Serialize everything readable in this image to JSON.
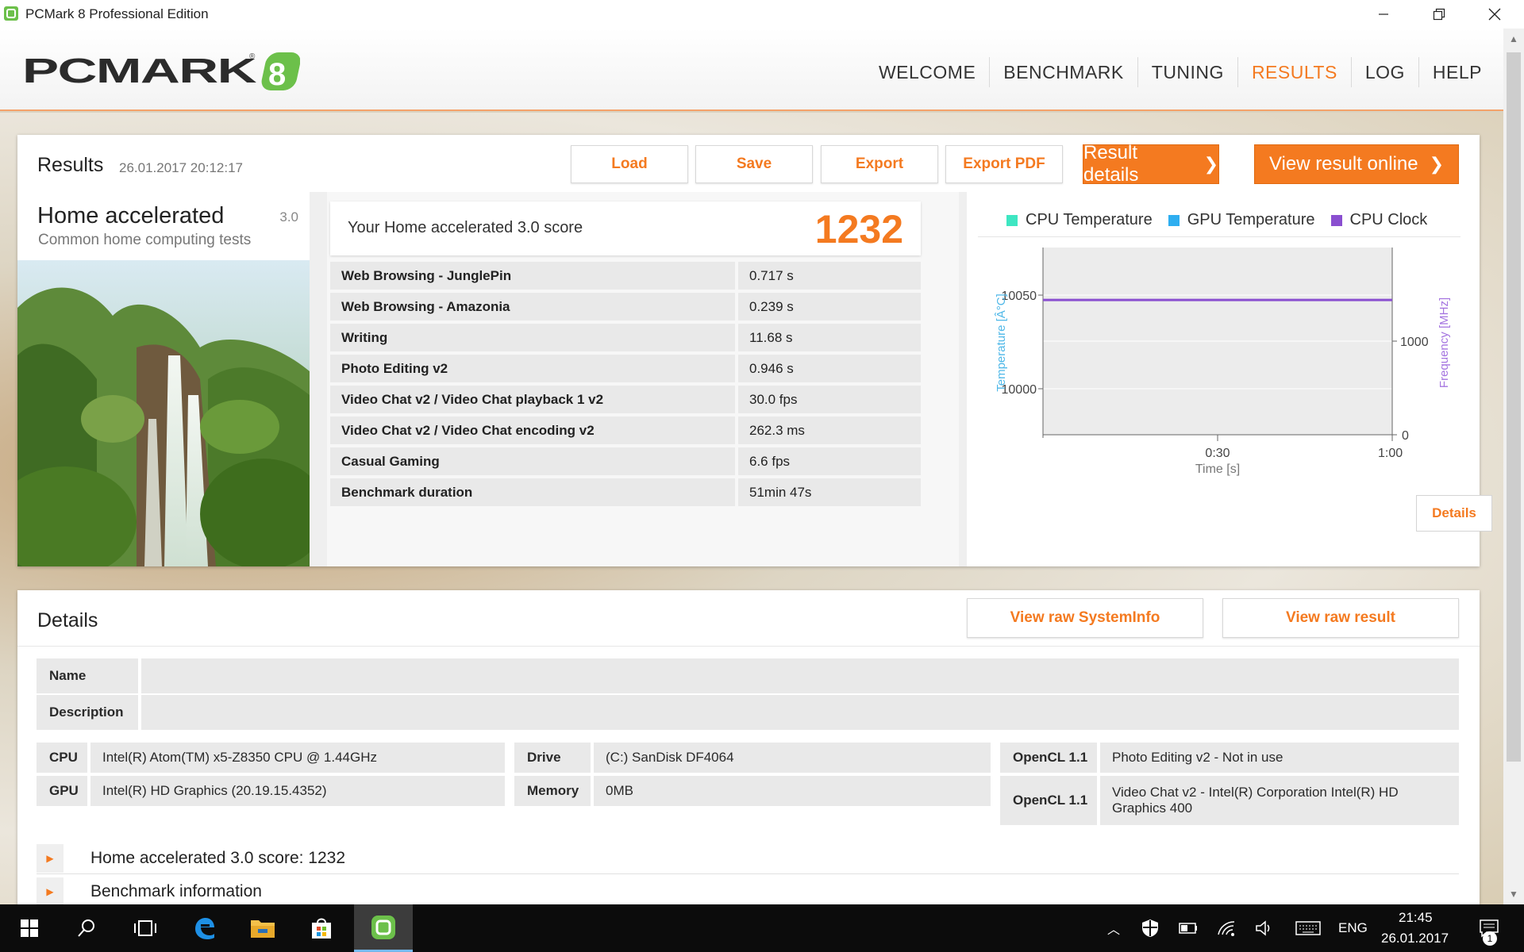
{
  "window": {
    "title": "PCMark 8 Professional Edition"
  },
  "brand": {
    "accent": "#f47a20"
  },
  "nav": [
    {
      "label": "WELCOME",
      "active": false
    },
    {
      "label": "BENCHMARK",
      "active": false
    },
    {
      "label": "TUNING",
      "active": false
    },
    {
      "label": "RESULTS",
      "active": true
    },
    {
      "label": "LOG",
      "active": false
    },
    {
      "label": "HELP",
      "active": false
    }
  ],
  "results": {
    "title": "Results",
    "date": "26.01.2017 20:12:17",
    "buttons": {
      "load": "Load",
      "save": "Save",
      "export": "Export",
      "export_pdf": "Export PDF",
      "result_details": "Result details",
      "view_online": "View result online"
    },
    "test": {
      "name": "Home accelerated",
      "version": "3.0",
      "description": "Common home computing tests"
    },
    "score": {
      "label": "Your Home accelerated 3.0 score",
      "value": "1232"
    },
    "subscores": [
      {
        "name": "Web Browsing - JunglePin",
        "value": "0.717 s"
      },
      {
        "name": "Web Browsing - Amazonia",
        "value": "0.239 s"
      },
      {
        "name": "Writing",
        "value": "11.68 s"
      },
      {
        "name": "Photo Editing v2",
        "value": "0.946 s"
      },
      {
        "name": "Video Chat v2 / Video Chat playback 1 v2",
        "value": "30.0 fps"
      },
      {
        "name": "Video Chat v2 / Video Chat encoding v2",
        "value": "262.3 ms"
      },
      {
        "name": "Casual Gaming",
        "value": "6.6 fps"
      },
      {
        "name": "Benchmark duration",
        "value": "51min 47s"
      }
    ],
    "details_button": "Details"
  },
  "chart_data": {
    "type": "line",
    "legend": [
      {
        "name": "CPU Temperature",
        "color": "#3ee6c2"
      },
      {
        "name": "GPU Temperature",
        "color": "#2eaef0"
      },
      {
        "name": "CPU Clock",
        "color": "#8a4fd0"
      }
    ],
    "xlabel": "Time [s]",
    "ylabel_left": "Temperature [Â°C]",
    "ylabel_right": "Frequency [MHz]",
    "x_ticks": [
      "0:30",
      "1:00"
    ],
    "y_left_ticks": [
      "10050",
      "10000"
    ],
    "y_right_ticks": [
      "1000",
      "0"
    ],
    "series": [
      {
        "name": "CPU Clock",
        "x": [
          0,
          60
        ],
        "y": [
          1440,
          1440
        ]
      }
    ],
    "y_right_range": [
      0,
      1750
    ],
    "x_range": [
      0,
      60
    ]
  },
  "details": {
    "title": "Details",
    "btn_sysinfo": "View raw SystemInfo",
    "btn_raw": "View raw result",
    "name_label": "Name",
    "desc_label": "Description",
    "cpu_label": "CPU",
    "cpu_value": "Intel(R) Atom(TM) x5-Z8350  CPU @ 1.44GHz",
    "gpu_label": "GPU",
    "gpu_value": "Intel(R) HD Graphics (20.19.15.4352)",
    "drive_label": "Drive",
    "drive_value": "(C:) SanDisk DF4064",
    "memory_label": "Memory",
    "memory_value": "0MB",
    "opencl1_label": "OpenCL 1.1",
    "opencl1_value": "Photo Editing v2 - Not in use",
    "opencl2_label": "OpenCL 1.1",
    "opencl2_value": "Video Chat v2 - Intel(R) Corporation Intel(R) HD Graphics 400",
    "expanders": [
      {
        "label": "Home accelerated 3.0 score: 1232"
      },
      {
        "label": "Benchmark information"
      }
    ]
  },
  "taskbar": {
    "lang": "ENG",
    "time": "21:45",
    "date": "26.01.2017",
    "notification_count": "1"
  }
}
